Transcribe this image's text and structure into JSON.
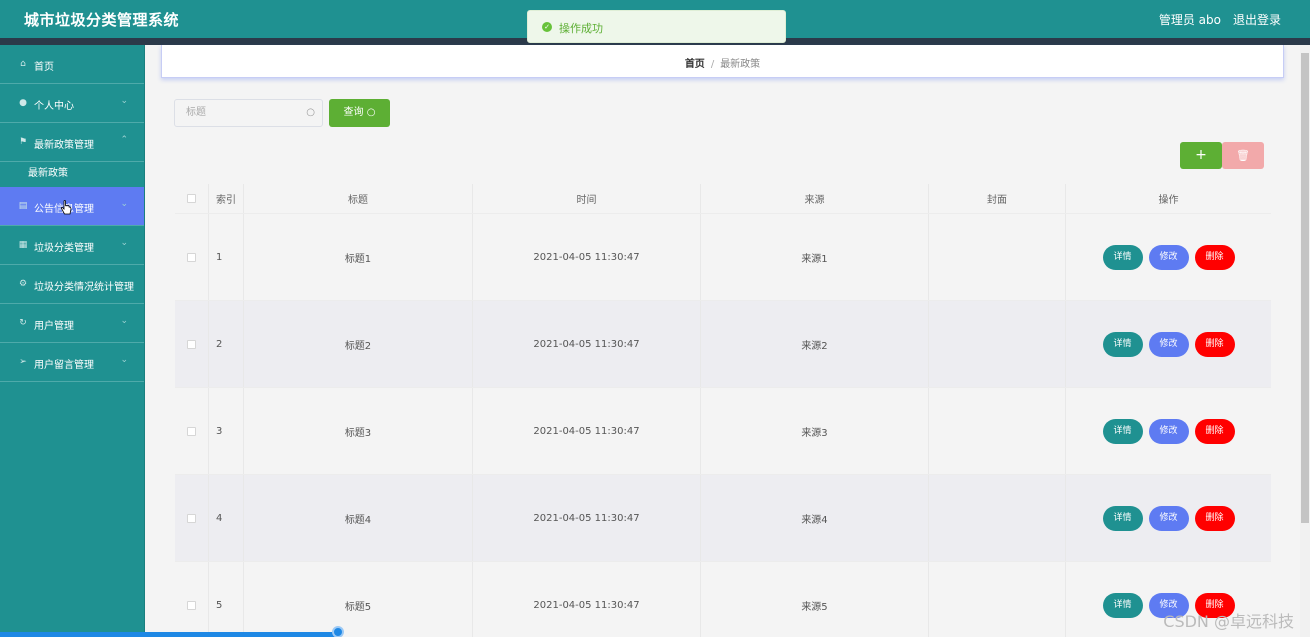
{
  "header": {
    "title": "城市垃圾分类管理系统",
    "user": "管理员 abo",
    "logout": "退出登录"
  },
  "toast": {
    "message": "操作成功"
  },
  "sidebar": {
    "items": [
      {
        "label": "首页",
        "icon": "home-icon"
      },
      {
        "label": "个人中心",
        "icon": "user-icon"
      },
      {
        "label": "最新政策管理",
        "icon": "flag-icon"
      },
      {
        "label": "最新政策",
        "icon": ""
      },
      {
        "label": "公告信息管理",
        "icon": "document-icon"
      },
      {
        "label": "垃圾分类管理",
        "icon": "grid-icon"
      },
      {
        "label": "垃圾分类情况统计管理",
        "icon": "gear-icon"
      },
      {
        "label": "用户管理",
        "icon": "refresh-icon"
      },
      {
        "label": "用户留言管理",
        "icon": "send-icon"
      }
    ]
  },
  "breadcrumb": {
    "home": "首页",
    "separator": "/",
    "current": "最新政策"
  },
  "search": {
    "placeholder": "标题",
    "button": "查询"
  },
  "toolbar": {
    "add": "+",
    "delete": "🗑"
  },
  "table": {
    "headers": {
      "index": "索引",
      "title": "标题",
      "time": "时间",
      "source": "来源",
      "cover": "封面",
      "ops": "操作"
    },
    "ops_labels": {
      "detail": "详情",
      "edit": "修改",
      "delete": "删除"
    },
    "rows": [
      {
        "index": "1",
        "title": "标题1",
        "time": "2021-04-05 11:30:47",
        "source": "来源1"
      },
      {
        "index": "2",
        "title": "标题2",
        "time": "2021-04-05 11:30:47",
        "source": "来源2"
      },
      {
        "index": "3",
        "title": "标题3",
        "time": "2021-04-05 11:30:47",
        "source": "来源3"
      },
      {
        "index": "4",
        "title": "标题4",
        "time": "2021-04-05 11:30:47",
        "source": "来源4"
      },
      {
        "index": "5",
        "title": "标题5",
        "time": "2021-04-05 11:30:47",
        "source": "来源5"
      }
    ]
  },
  "watermark": "CSDN @卓远科技",
  "colors": {
    "primary": "#1f9191",
    "active": "#5e7bf2",
    "success": "#5daf34",
    "danger": "#ff0000"
  }
}
